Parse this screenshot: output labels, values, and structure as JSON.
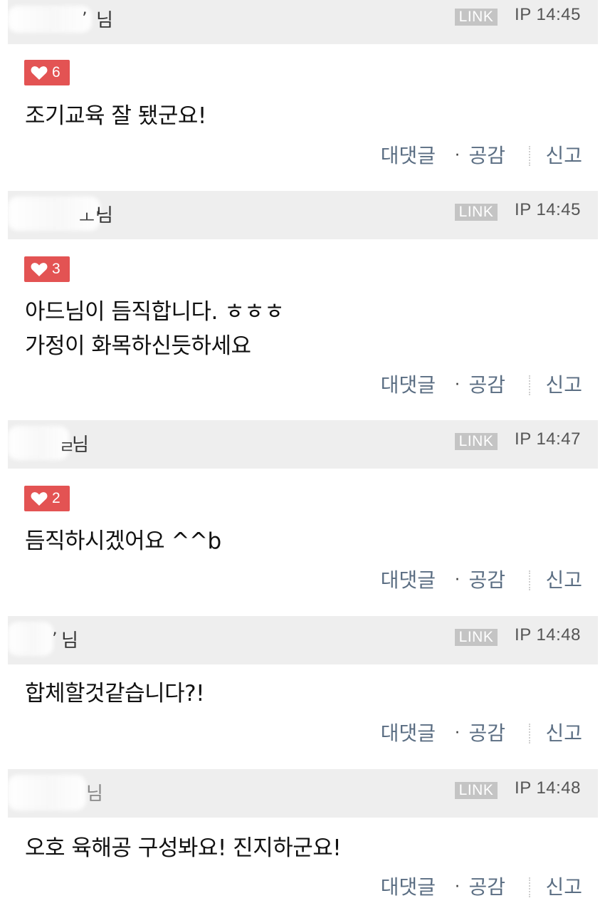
{
  "comments": [
    {
      "author_fragment": "’",
      "author_suffix": "님",
      "link": "LINK",
      "ip_time": "IP 14:45",
      "likes": "6",
      "lines": [
        "조기교육 잘 됐군요!"
      ],
      "actions": {
        "reply": "대댓글",
        "dot": "·",
        "like": "공감",
        "report": "신고"
      }
    },
    {
      "author_fragment": "ㅗ'",
      "author_suffix": "님",
      "link": "LINK",
      "ip_time": "IP 14:45",
      "likes": "3",
      "lines": [
        "아드님이 듬직합니다. ㅎㅎㅎ",
        "가정이 화목하신듯하세요"
      ],
      "actions": {
        "reply": "대댓글",
        "dot": "·",
        "like": "공감",
        "report": "신고"
      }
    },
    {
      "author_fragment": "ㄹ",
      "author_suffix": "님",
      "link": "LINK",
      "ip_time": "IP 14:47",
      "likes": "2",
      "lines": [
        "듬직하시겠어요 ^^b"
      ],
      "actions": {
        "reply": "대댓글",
        "dot": "·",
        "like": "공감",
        "report": "신고"
      }
    },
    {
      "author_fragment": "’",
      "author_suffix": "님",
      "link": "LINK",
      "ip_time": "IP 14:48",
      "likes": "",
      "lines": [
        "합체할것같습니다?!"
      ],
      "actions": {
        "reply": "대댓글",
        "dot": "·",
        "like": "공감",
        "report": "신고"
      }
    },
    {
      "author_fragment": "",
      "author_suffix": "님",
      "link": "LINK",
      "ip_time": "IP 14:48",
      "likes": "",
      "lines": [
        "오호 육해공 구성봐요! 진지하군요!"
      ],
      "actions": {
        "reply": "대댓글",
        "dot": "·",
        "like": "공감",
        "report": "신고"
      }
    }
  ],
  "colors": {
    "header_bg": "#eeeeee",
    "like_badge": "#e35353",
    "link_badge": "#c4c4c4",
    "action_text": "#5b6e83"
  },
  "icons": {
    "like": "heart-icon"
  }
}
